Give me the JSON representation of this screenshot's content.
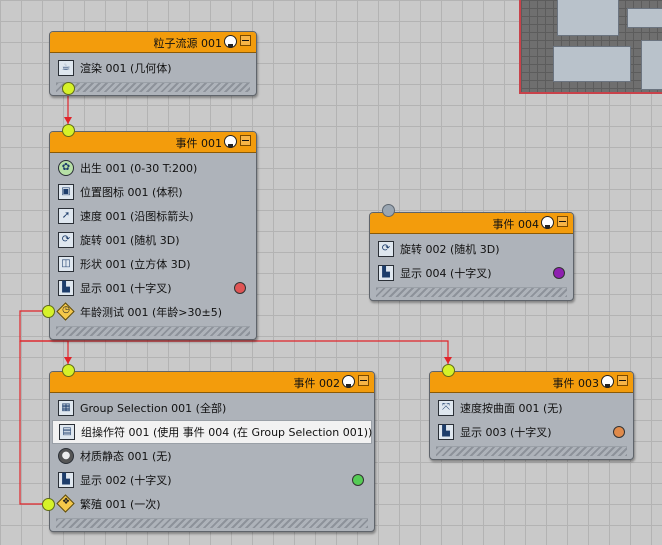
{
  "nodes": {
    "source": {
      "title": "粒子流源 001",
      "ops": [
        {
          "icon": "teapot-icon",
          "label": "渲染 001 (几何体)"
        }
      ]
    },
    "event001": {
      "title": "事件 001",
      "ops": [
        {
          "icon": "birth-icon",
          "label": "出生 001 (0-30 T:200)"
        },
        {
          "icon": "position-icon-icon",
          "label": "位置图标 001 (体积)"
        },
        {
          "icon": "speed-icon",
          "label": "速度 001 (沿图标箭头)"
        },
        {
          "icon": "rotation-icon",
          "label": "旋转 001 (随机 3D)"
        },
        {
          "icon": "shape-icon",
          "label": "形状 001 (立方体 3D)"
        },
        {
          "icon": "display-icon",
          "label": "显示 001 (十字叉)",
          "swatch": "#e05555"
        },
        {
          "icon": "age-test-icon",
          "label": "年龄测试 001 (年龄>30±5)",
          "test": true
        }
      ]
    },
    "event004": {
      "title": "事件 004",
      "ops": [
        {
          "icon": "rotation-icon",
          "label": "旋转 002 (随机 3D)"
        },
        {
          "icon": "display-icon",
          "label": "显示 004 (十字叉)",
          "swatch": "#8e1fb0"
        }
      ]
    },
    "event002": {
      "title": "事件 002",
      "ops": [
        {
          "icon": "group-selection-icon",
          "label": "Group Selection 001 (全部)"
        },
        {
          "icon": "group-operator-icon",
          "label": "组操作符 001 (使用 事件 004 (在 Group Selection 001))",
          "highlight": true
        },
        {
          "icon": "material-static-icon",
          "label": "材质静态 001 (无)"
        },
        {
          "icon": "display-icon",
          "label": "显示 002 (十字叉)",
          "swatch": "#55cc55"
        },
        {
          "icon": "spawn-test-icon",
          "label": "繁殖 001 (一次)",
          "test": true
        }
      ]
    },
    "event003": {
      "title": "事件 003",
      "ops": [
        {
          "icon": "speed-by-surface-icon",
          "label": "速度按曲面 001 (无)"
        },
        {
          "icon": "display-icon",
          "label": "显示 003 (十字叉)",
          "swatch": "#e08a4a"
        }
      ]
    }
  },
  "colors": {
    "header": "#f39c0c",
    "wire": "#e0242a",
    "port": "#d6f229"
  }
}
